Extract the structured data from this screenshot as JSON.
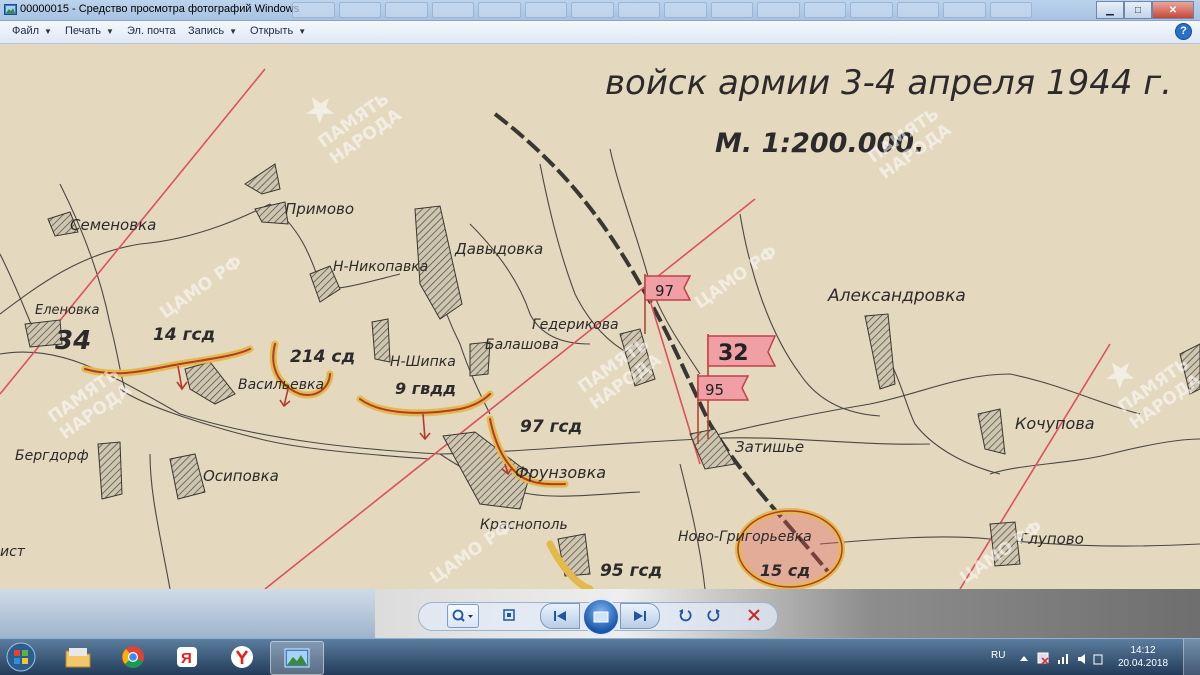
{
  "window": {
    "title": "00000015 - Средство просмотра фотографий Windows",
    "controls": {
      "minimize": "▁",
      "maximize": "□",
      "close": "✕"
    }
  },
  "menu": {
    "items": [
      {
        "label": "Файл",
        "has_dropdown": true
      },
      {
        "label": "Печать",
        "has_dropdown": true
      },
      {
        "label": "Эл. почта",
        "has_dropdown": false
      },
      {
        "label": "Запись",
        "has_dropdown": true
      },
      {
        "label": "Открыть",
        "has_dropdown": true
      }
    ],
    "help_label": "?"
  },
  "map": {
    "heading_line1": "войск армии 3-4 апреля 1944 г.",
    "heading_line2": "М. 1:200.000.",
    "places": {
      "semenovka": "Семеновка",
      "primovo": "Примово",
      "n_nikopol": "Н-Никопавка",
      "davydovka": "Давыдовка",
      "elenovka": "Еленовка",
      "tederiko": "Гедерикова",
      "balashova": "Балашова",
      "n_shipka": "Н-Шипка",
      "vasilievka": "Васильевка",
      "aleksandrovka": "Александровка",
      "kochupova": "Кочупова",
      "zatishie": "Затишье",
      "frunzovka": "Фрунзовка",
      "bergdorf": "Бергдорф",
      "osipovka": "Осиповка",
      "krasnopol": "Краснополь",
      "novo_gr": "Ново-Григорьевка",
      "glupovo": "Глупово",
      "ist": "ист"
    },
    "units": {
      "u34": "34",
      "u14": "14 гсд",
      "u214": "214 сд",
      "u9": "9 гвдд",
      "u97": "97 гсд",
      "u95": "95 гсд",
      "u15": "15 сд"
    },
    "flags": {
      "f97": "97",
      "f32": "32",
      "f95": "95"
    },
    "watermarks": {
      "pamyat": "ПАМЯТЬ",
      "naroda": "НАРОДА",
      "camo": "ЦАМО РФ"
    },
    "colors": {
      "paper": "#e4d9bf",
      "red_line": "#e0505a",
      "front_yellow": "#e3b94a",
      "front_red": "#b23b2b",
      "ink": "#2c2a2a"
    }
  },
  "viewer_controls": {
    "zoom": "zoom-icon",
    "fit": "actual-size-icon",
    "prev": "previous-icon",
    "slideshow": "slideshow-icon",
    "next": "next-icon",
    "rotate_ccw": "rotate-left-icon",
    "rotate_cw": "rotate-right-icon",
    "delete": "delete-icon"
  },
  "taskbar": {
    "apps": [
      "start",
      "explorer",
      "chrome",
      "yandex-browser",
      "yandex",
      "photo-viewer"
    ],
    "language": "RU",
    "time": "14:12",
    "date": "20.04.2018"
  }
}
